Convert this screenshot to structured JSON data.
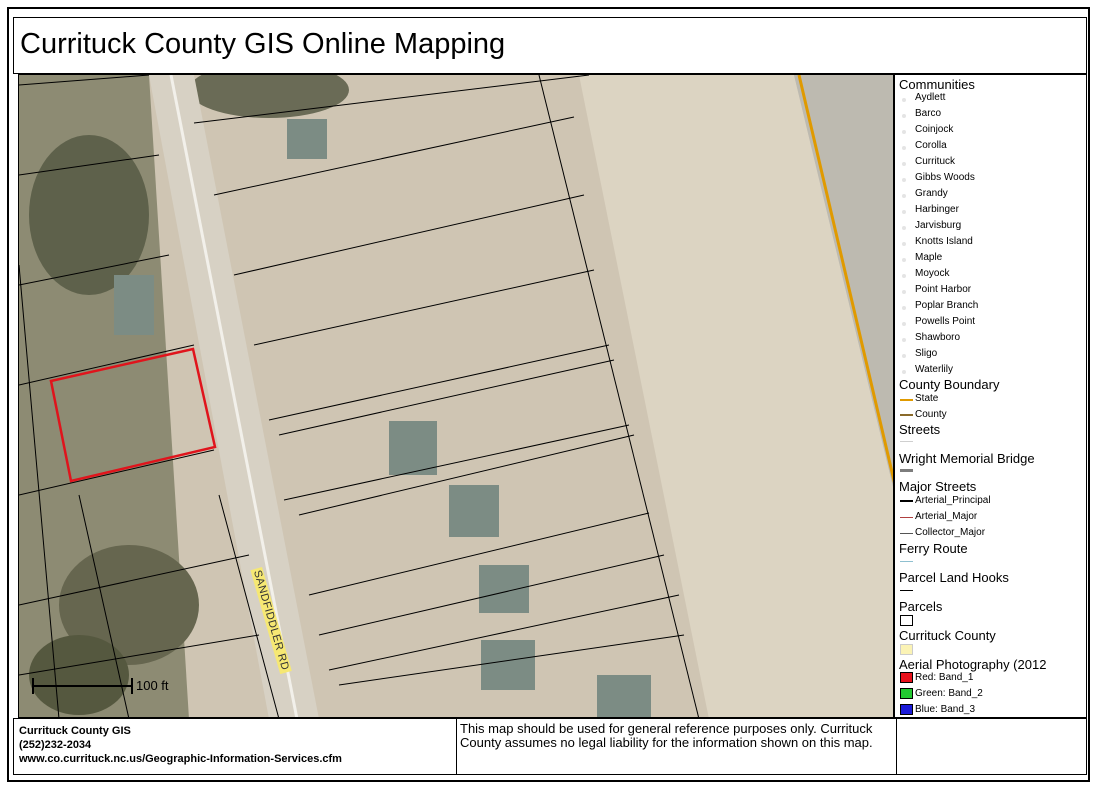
{
  "title": "Currituck County GIS Online Mapping",
  "map": {
    "road_label": "SANDFIDDLER RD",
    "scale_label": "100 ft",
    "selection_color": "#e0141c",
    "state_line_color": "#e09a00"
  },
  "legend": {
    "communities_title": "Communities",
    "communities": [
      "Aydlett",
      "Barco",
      "Coinjock",
      "Corolla",
      "Currituck",
      "Gibbs Woods",
      "Grandy",
      "Harbinger",
      "Jarvisburg",
      "Knotts Island",
      "Maple",
      "Moyock",
      "Point Harbor",
      "Poplar Branch",
      "Powells Point",
      "Shawboro",
      "Sligo",
      "Waterlily"
    ],
    "county_boundary_title": "County Boundary",
    "county_boundary": [
      "State",
      "County"
    ],
    "streets_title": "Streets",
    "bridge_title": "Wright Memorial Bridge",
    "major_streets_title": "Major Streets",
    "major_streets": [
      "Arterial_Principal",
      "Arterial_Major",
      "Collector_Major"
    ],
    "ferry_title": "Ferry Route",
    "parcel_hooks_title": "Parcel Land Hooks",
    "parcels_title": "Parcels",
    "county_title": "Currituck County",
    "aerial_title": "Aerial Photography (2012",
    "bands": [
      {
        "label": "Red:   Band_1",
        "color": "#e8121c"
      },
      {
        "label": "Green: Band_2",
        "color": "#22c831"
      },
      {
        "label": "Blue:   Band_3",
        "color": "#1a1ad8"
      }
    ]
  },
  "footer": {
    "org": "Currituck County GIS",
    "phone": "(252)232-2034",
    "url": "www.co.currituck.nc.us/Geographic-Information-Services.cfm",
    "disclaimer": "This map should be used for general reference purposes only. Currituck County assumes no legal liability for the information shown on this map."
  }
}
